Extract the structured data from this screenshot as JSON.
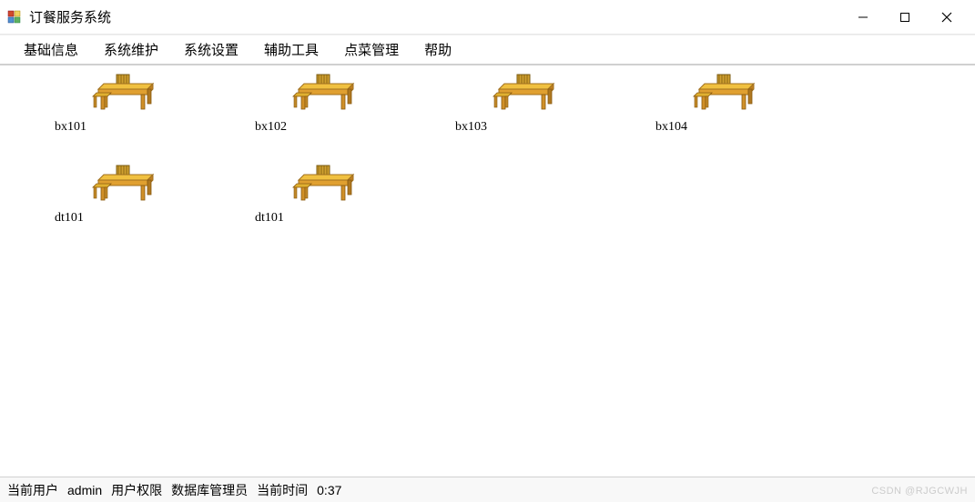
{
  "window": {
    "title": "订餐服务系统"
  },
  "menubar": {
    "items": [
      {
        "label": "基础信息"
      },
      {
        "label": "系统维护"
      },
      {
        "label": "系统设置"
      },
      {
        "label": "辅助工具"
      },
      {
        "label": "点菜管理"
      },
      {
        "label": "帮助"
      }
    ]
  },
  "tables": [
    {
      "label": "bx101"
    },
    {
      "label": "bx102"
    },
    {
      "label": "bx103"
    },
    {
      "label": "bx104"
    },
    {
      "label": "dt101"
    },
    {
      "label": "dt101"
    }
  ],
  "statusbar": {
    "user_label": "当前用户",
    "user_value": "admin",
    "perm_label": "用户权限",
    "perm_value": "数据库管理员",
    "time_label": "当前时间",
    "time_value": "0:37"
  },
  "watermark": "CSDN @RJGCWJH"
}
